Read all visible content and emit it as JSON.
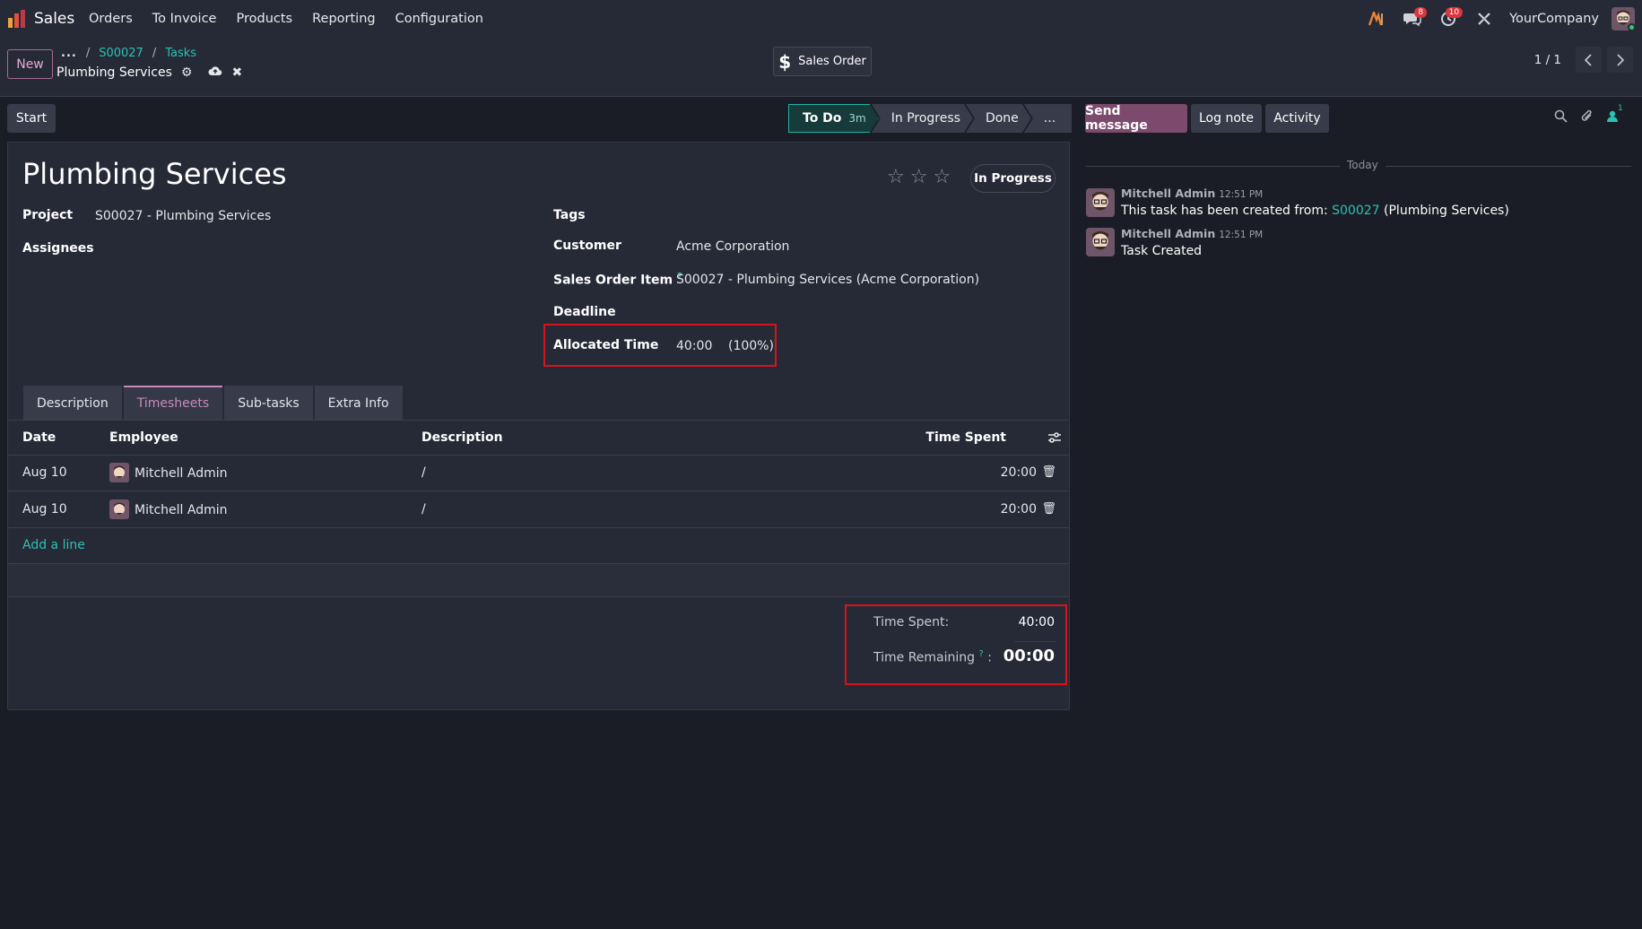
{
  "navbar": {
    "app_name": "Sales",
    "menu": [
      "Orders",
      "To Invoice",
      "Products",
      "Reporting",
      "Configuration"
    ],
    "messages_badge": "8",
    "activities_badge": "10",
    "company": "YourCompany"
  },
  "control_panel": {
    "new_label": "New",
    "breadcrumb_dots": "...",
    "breadcrumb_1": "S00027",
    "breadcrumb_2": "Tasks",
    "record_name": "Plumbing Services",
    "smart_button": "Sales Order",
    "pager": "1 / 1"
  },
  "statusbar": {
    "start_label": "Start",
    "stages": [
      {
        "label": "To Do",
        "duration": "3m"
      },
      {
        "label": "In Progress"
      },
      {
        "label": "Done"
      },
      {
        "label": "..."
      }
    ]
  },
  "form": {
    "title": "Plumbing Services",
    "state": "In Progress",
    "project_label": "Project",
    "project_value": "S00027 - Plumbing Services",
    "assignees_label": "Assignees",
    "tags_label": "Tags",
    "customer_label": "Customer",
    "customer_value": "Acme Corporation",
    "sales_order_item_label": "Sales Order Item",
    "sales_order_item_value": "S00027 - Plumbing Services (Acme Corporation)",
    "deadline_label": "Deadline",
    "allocated_time_label": "Allocated Time",
    "allocated_time_value": "40:00",
    "allocated_time_percent": "(100%)",
    "help_mark": "?"
  },
  "tabs": [
    "Description",
    "Timesheets",
    "Sub-tasks",
    "Extra Info"
  ],
  "timesheets": {
    "columns": [
      "Date",
      "Employee",
      "Description",
      "Time Spent"
    ],
    "rows": [
      {
        "date": "Aug 10",
        "employee": "Mitchell Admin",
        "description": "/",
        "time": "20:00"
      },
      {
        "date": "Aug 10",
        "employee": "Mitchell Admin",
        "description": "/",
        "time": "20:00"
      }
    ],
    "add_line": "Add a line",
    "time_spent_label": "Time Spent:",
    "time_spent_value": "40:00",
    "time_remaining_label": "Time Remaining",
    "time_remaining_suffix": ":",
    "time_remaining_value": "00:00"
  },
  "chatter": {
    "send_message": "Send message",
    "log_note": "Log note",
    "activity": "Activity",
    "followers_count": "1",
    "date_separator": "Today",
    "messages": [
      {
        "author": "Mitchell Admin",
        "time": "12:51 PM",
        "body_prefix": "This task has been created from: ",
        "link": "S00027",
        "body_suffix": " (Plumbing Services)"
      },
      {
        "author": "Mitchell Admin",
        "time": "12:51 PM",
        "body": "Task Created"
      }
    ]
  },
  "colors": {
    "accent_teal": "#2bc1b3",
    "accent_pink": "#c98ab9",
    "send_message_bg": "#7b4a6d",
    "highlight_box": "#d8131b"
  }
}
